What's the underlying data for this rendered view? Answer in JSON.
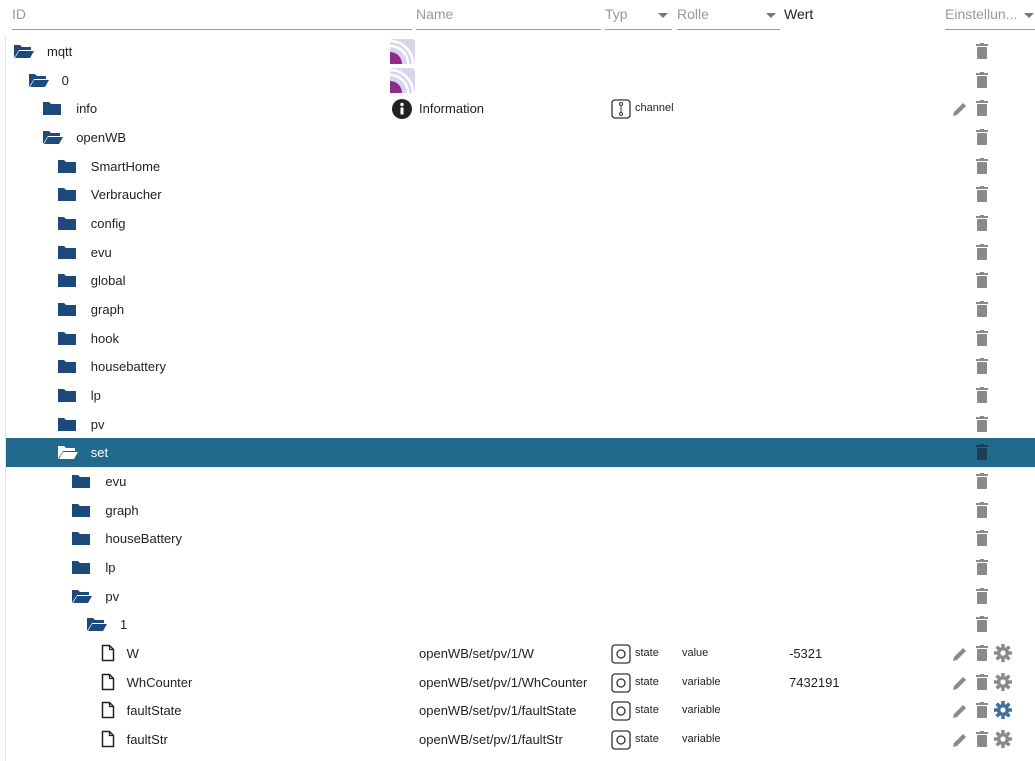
{
  "headers": {
    "id": "ID",
    "name": "Name",
    "typ": "Typ",
    "rolle": "Rolle",
    "wert": "Wert",
    "settings": "Einstellun..."
  },
  "colors": {
    "folder": "#1c4a7a",
    "selected": "#226a8d",
    "icon_gray": "#8a8a8a",
    "gear_active": "#3f6f9e"
  },
  "rows": [
    {
      "id": "mqtt",
      "level": 0,
      "icon": "folder-open-icon",
      "name_icon": "mqtt-adapter-icon"
    },
    {
      "id": "0",
      "level": 1,
      "icon": "folder-open-icon",
      "name_icon": "mqtt-adapter-icon"
    },
    {
      "id": "info",
      "level": 2,
      "icon": "folder-icon",
      "name_icon": "info-icon",
      "name": "Information",
      "type_icon": "channel-icon",
      "type": "channel",
      "edit": true
    },
    {
      "id": "openWB",
      "level": 2,
      "icon": "folder-open-icon"
    },
    {
      "id": "SmartHome",
      "level": 3,
      "icon": "folder-icon"
    },
    {
      "id": "Verbraucher",
      "level": 3,
      "icon": "folder-icon"
    },
    {
      "id": "config",
      "level": 3,
      "icon": "folder-icon"
    },
    {
      "id": "evu",
      "level": 3,
      "icon": "folder-icon"
    },
    {
      "id": "global",
      "level": 3,
      "icon": "folder-icon"
    },
    {
      "id": "graph",
      "level": 3,
      "icon": "folder-icon"
    },
    {
      "id": "hook",
      "level": 3,
      "icon": "folder-icon"
    },
    {
      "id": "housebattery",
      "level": 3,
      "icon": "folder-icon"
    },
    {
      "id": "lp",
      "level": 3,
      "icon": "folder-icon"
    },
    {
      "id": "pv",
      "level": 3,
      "icon": "folder-icon"
    },
    {
      "id": "set",
      "level": 3,
      "icon": "folder-open-icon",
      "selected": true
    },
    {
      "id": "evu",
      "level": 4,
      "icon": "folder-icon"
    },
    {
      "id": "graph",
      "level": 4,
      "icon": "folder-icon"
    },
    {
      "id": "houseBattery",
      "level": 4,
      "icon": "folder-icon"
    },
    {
      "id": "lp",
      "level": 4,
      "icon": "folder-icon"
    },
    {
      "id": "pv",
      "level": 4,
      "icon": "folder-open-icon"
    },
    {
      "id": "1",
      "level": 5,
      "icon": "folder-open-icon"
    },
    {
      "id": "W",
      "level": 6,
      "icon": "file-icon",
      "name": "openWB/set/pv/1/W",
      "type_icon": "state-icon",
      "type": "state",
      "role": "value",
      "value": "-5321",
      "edit": true,
      "gear": true
    },
    {
      "id": "WhCounter",
      "level": 6,
      "icon": "file-icon",
      "name": "openWB/set/pv/1/WhCounter",
      "type_icon": "state-icon",
      "type": "state",
      "role": "variable",
      "value": "7432191",
      "edit": true,
      "gear": true
    },
    {
      "id": "faultState",
      "level": 6,
      "icon": "file-icon",
      "name": "openWB/set/pv/1/faultState",
      "type_icon": "state-icon",
      "type": "state",
      "role": "variable",
      "edit": true,
      "gear": true,
      "gear_active": true
    },
    {
      "id": "faultStr",
      "level": 6,
      "icon": "file-icon",
      "name": "openWB/set/pv/1/faultStr",
      "type_icon": "state-icon",
      "type": "state",
      "role": "variable",
      "edit": true,
      "gear": true
    }
  ]
}
